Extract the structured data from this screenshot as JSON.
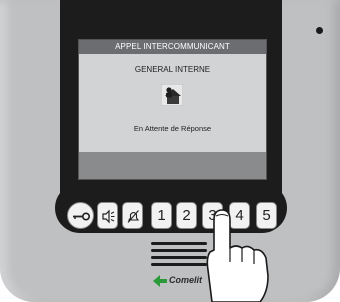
{
  "screen": {
    "title": "APPEL INTERCOMMUNICANT",
    "subtitle": "GENERAL INTERNE",
    "status": "En Attente de Réponse",
    "icon": "user-house-icon"
  },
  "keypad": {
    "keys": [
      {
        "icon": "key-icon"
      },
      {
        "icon": "speaker-volume-icon"
      },
      {
        "icon": "bell-mute-icon"
      },
      {
        "label": "1"
      },
      {
        "label": "2"
      },
      {
        "label": "3"
      },
      {
        "label": "4"
      },
      {
        "label": "5"
      }
    ]
  },
  "brand": {
    "name": "Comelit"
  },
  "colors": {
    "device": "#bfc0c2",
    "bezel": "#1c1c1c",
    "logo_green": "#2a9a3a"
  }
}
